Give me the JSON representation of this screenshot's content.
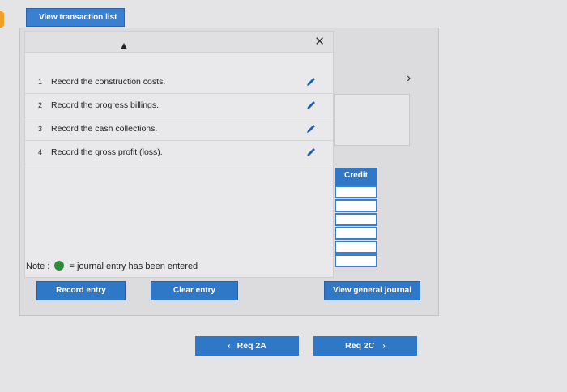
{
  "header": {
    "view_transaction_list": "View transaction list"
  },
  "popup": {
    "close_glyph": "✕",
    "rows": [
      {
        "num": "1",
        "label": "Record the construction costs."
      },
      {
        "num": "2",
        "label": "Record the progress billings."
      },
      {
        "num": "3",
        "label": "Record the cash collections."
      },
      {
        "num": "4",
        "label": "Record the gross profit (loss)."
      }
    ]
  },
  "panel": {
    "chevron": "›",
    "credit_header": "Credit"
  },
  "note": {
    "prefix": "Note :",
    "suffix": "= journal entry has been entered"
  },
  "buttons": {
    "record_entry": "Record entry",
    "clear_entry": "Clear entry",
    "view_general_journal": "View general journal"
  },
  "nav": {
    "prev_label": "Req 2A",
    "next_label": "Req 2C",
    "prev_glyph": "‹",
    "next_glyph": "›"
  },
  "colors": {
    "accent": "#2f78c8",
    "entered_dot": "#2e8b3d"
  },
  "icons": {
    "edit": "pencil-icon",
    "close": "close-icon",
    "next": "chevron-right-icon"
  }
}
